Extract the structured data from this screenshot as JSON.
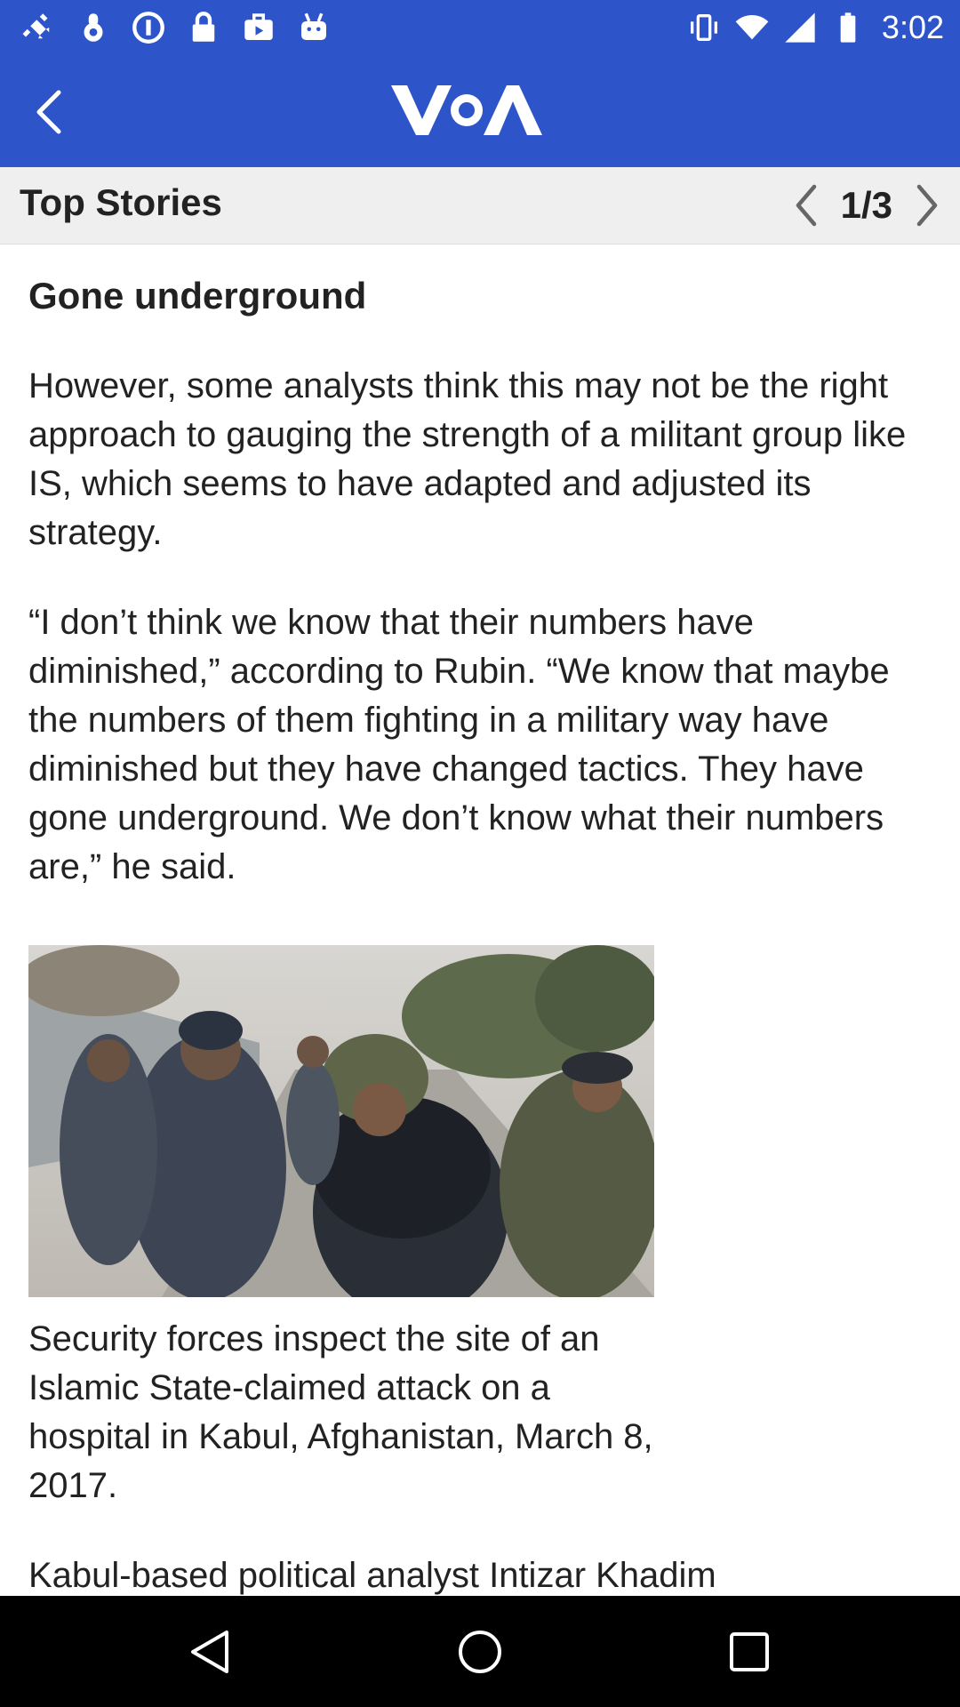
{
  "status_bar": {
    "time": "3:02",
    "icons": [
      "satellite-icon",
      "notification-icon",
      "info-icon",
      "lock-icon",
      "briefcase-icon",
      "android-icon",
      "vibrate-icon",
      "wifi-icon",
      "signal-icon",
      "battery-icon"
    ]
  },
  "app_bar": {
    "logo_text": "VOA",
    "back_icon": "back-arrow-icon",
    "color": "#2d54c9"
  },
  "section_bar": {
    "title": "Top Stories",
    "pager": "1/3"
  },
  "article": {
    "headline": "Gone underground",
    "paragraphs": [
      "However, some analysts think this may not be the right approach to gauging the strength of a militant group like IS, which seems to have adapted and adjusted its strategy.",
      "“I don’t think we know that their numbers have diminished,” according to Rubin. “We know that maybe the numbers of them fighting in a military way have diminished but they have changed tactics. They have gone underground. We don’t know what their numbers are,” he said."
    ],
    "caption": "Security forces inspect the site of an Islamic State-claimed attack on a hospital in Kabul, Afghanistan, March 8, 2017.",
    "last_paragraph": "Kabul-based political analyst Intizar Khadim"
  },
  "nav_bar": {
    "buttons": [
      "back-triangle-icon",
      "home-circle-icon",
      "recents-square-icon"
    ]
  }
}
